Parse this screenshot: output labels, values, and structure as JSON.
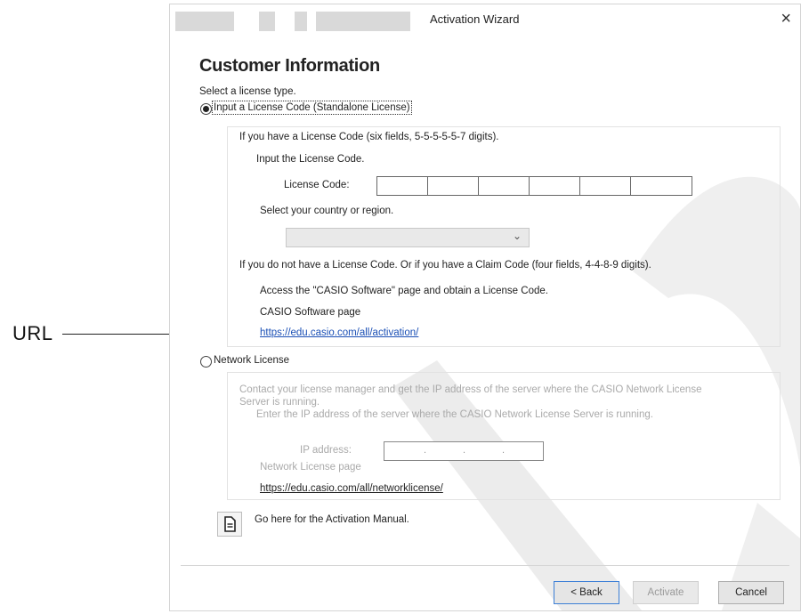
{
  "window": {
    "title": "Activation Wizard",
    "close_glyph": "×"
  },
  "page": {
    "heading": "Customer Information",
    "prompt": "Select a license type."
  },
  "standalone": {
    "radio_label": "Input a License Code (Standalone License)",
    "selected": true,
    "desc": "If you have a License Code (six fields, 5-5-5-5-5-7 digits).",
    "input_prompt": "Input the License Code.",
    "license_code_label": "License Code:",
    "license_code_fields": [
      "",
      "",
      "",
      "",
      "",
      ""
    ],
    "country_prompt": "Select your country or region.",
    "country_value": "",
    "no_code_text": "If you do not have a License Code. Or if you have a Claim Code (four fields, 4-4-8-9 digits).",
    "access_text": "Access the \"CASIO Software\" page and obtain a License Code.",
    "software_page_label": "CASIO Software page",
    "software_url": "https://edu.casio.com/all/activation/"
  },
  "network": {
    "radio_label": "Network License",
    "selected": false,
    "contact_text_1": "Contact your license manager and get the IP address of the server where the CASIO Network License",
    "contact_text_2": "Server is running.",
    "enter_ip_text": "Enter the IP address of the server where the CASIO Network License Server is running.",
    "ip_label": "IP address:",
    "ip_separator": ".",
    "page_label": "Network License page",
    "page_url": "https://edu.casio.com/all/networklicense/"
  },
  "manual": {
    "text": "Go here for the Activation Manual.",
    "icon": "document-icon"
  },
  "buttons": {
    "back": "< Back",
    "activate": "Activate",
    "cancel": "Cancel"
  },
  "callout": {
    "label": "URL"
  },
  "colors": {
    "link": "#1a4fb5",
    "watermark": "#e6e6e6"
  }
}
